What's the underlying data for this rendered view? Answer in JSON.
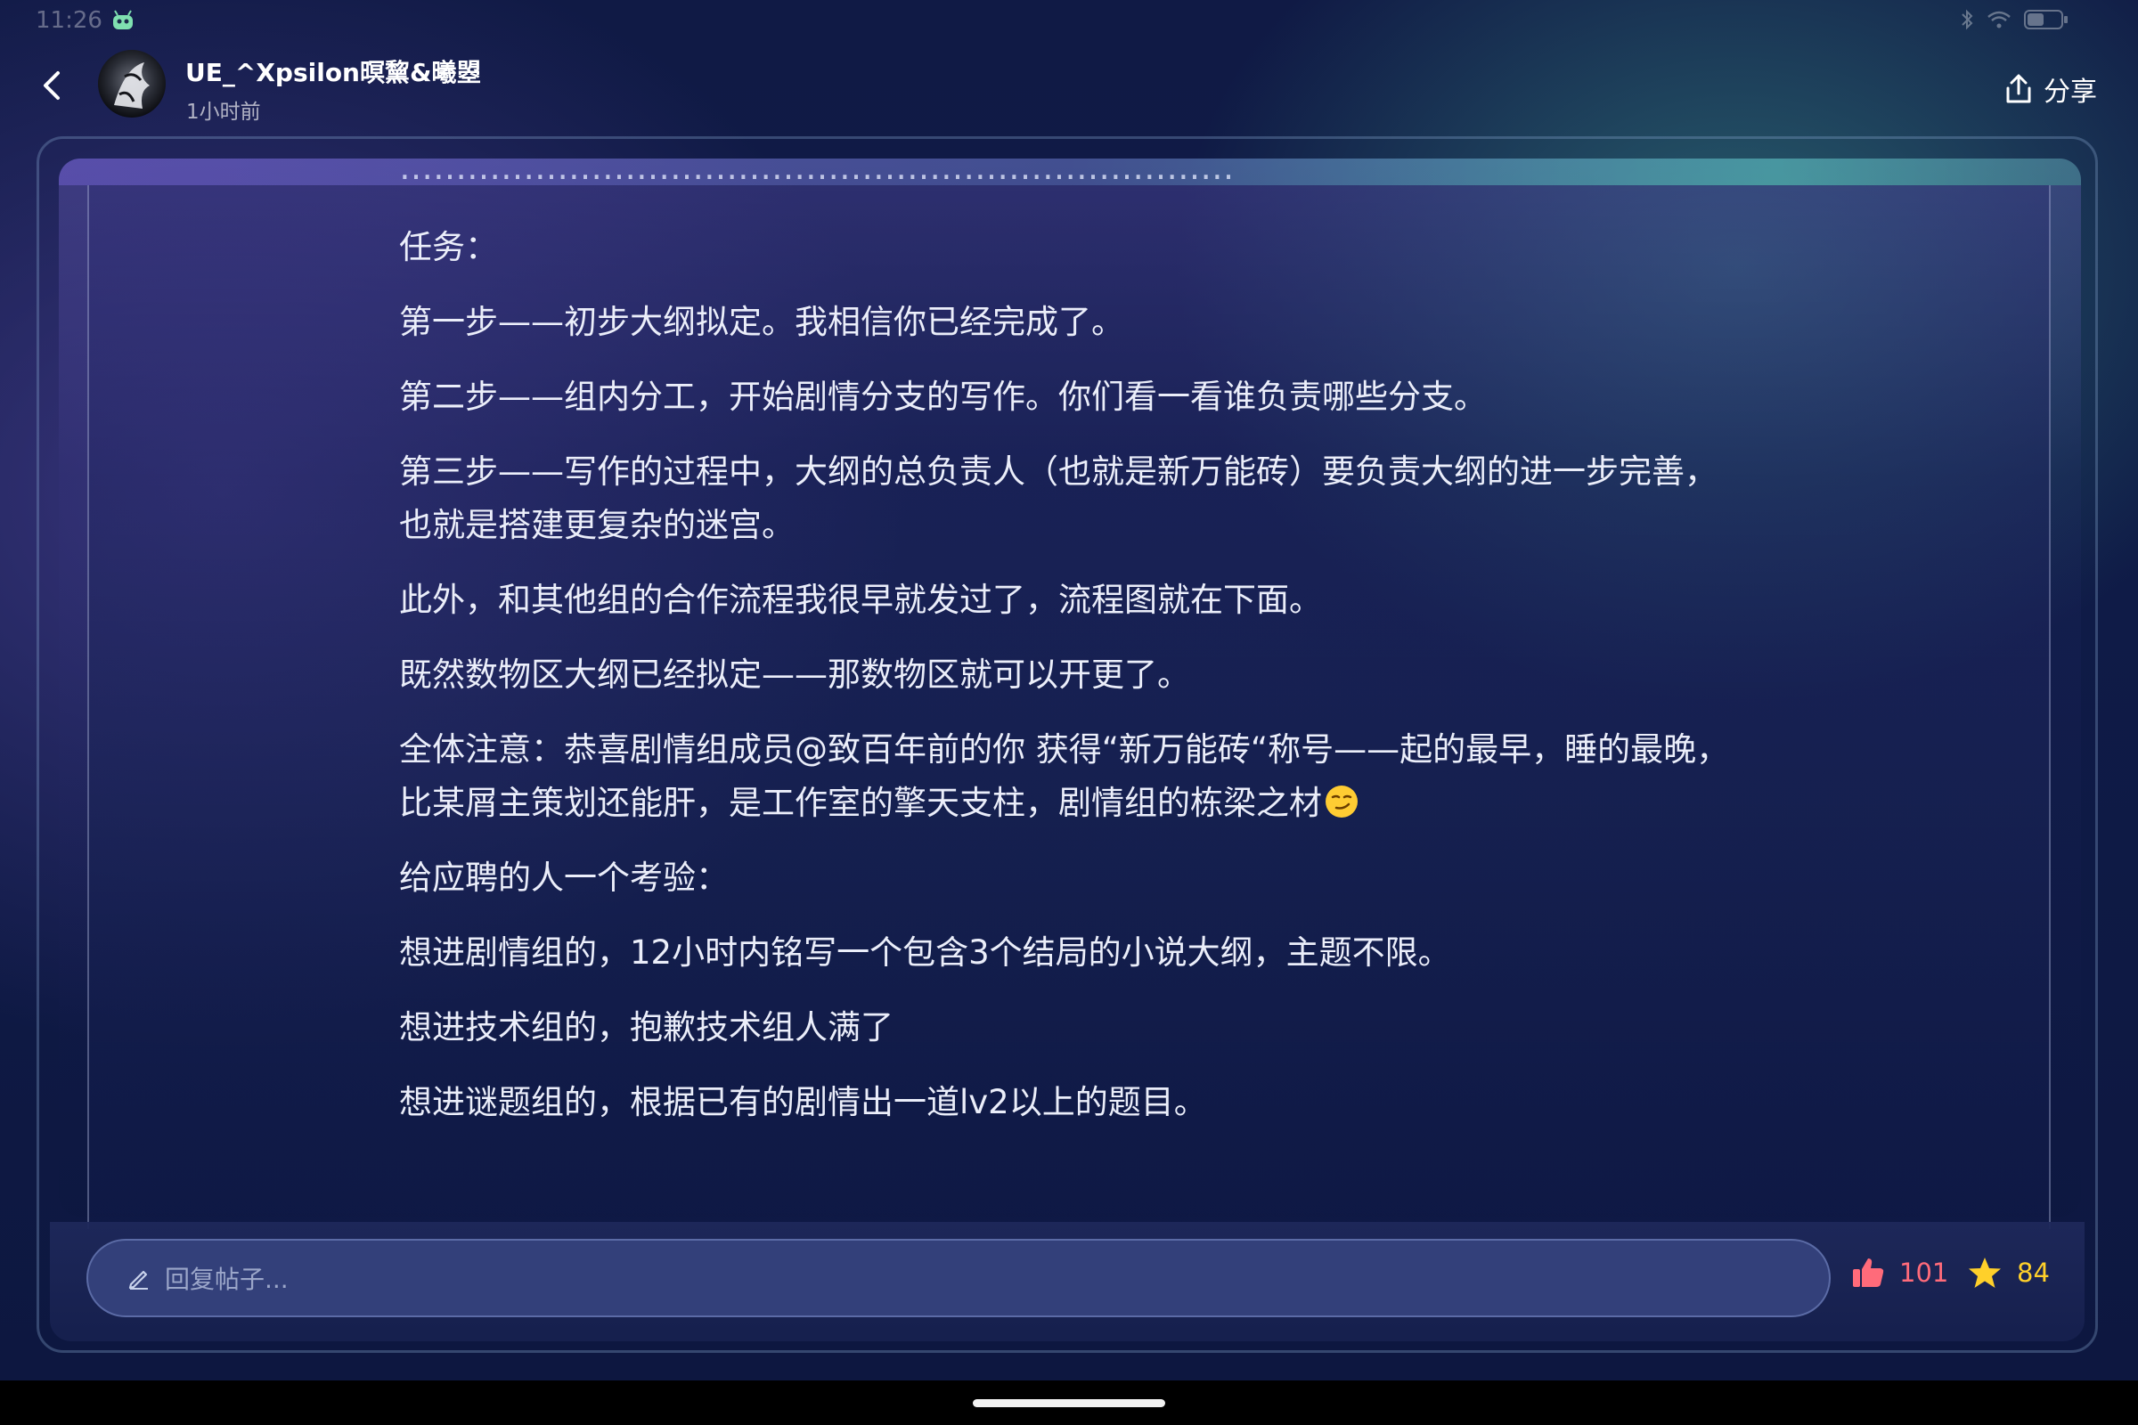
{
  "status_bar": {
    "time": "11:26",
    "icons": [
      "app-robot-icon",
      "bluetooth-icon",
      "wifi-icon",
      "battery-icon"
    ]
  },
  "header": {
    "back_icon": "chevron-left-icon",
    "username": "UE_^Xpsilon暝黧&曦曌",
    "post_time": "1小时前",
    "share_label": "分享",
    "share_icon": "share-icon"
  },
  "post": {
    "paragraphs": [
      "任务：",
      "第一步——初步大纲拟定。我相信你已经完成了。",
      "第二步——组内分工，开始剧情分支的写作。你们看一看谁负责哪些分支。",
      "第三步——写作的过程中，大纲的总负责人（也就是新万能砖）要负责大纲的进一步完善，也就是搭建更复杂的迷宫。",
      "此外，和其他组的合作流程我很早就发过了，流程图就在下面。",
      "既然数物区大纲已经拟定——那数物区就可以开更了。",
      "全体注意：恭喜剧情组成员@致百年前的你 获得“新万能砖“称号——起的最早，睡的最晚，比某屑主策划还能肝，是工作室的擎天支柱，剧情组的栋梁之材",
      "给应聘的人一个考验：",
      "想进剧情组的，12小时内铭写一个包含3个结局的小说大纲，主题不限。",
      "想进技术组的，抱歉技术组人满了",
      "想进谜题组的，根据已有的剧情出一道lv2以上的题目。"
    ],
    "emoji_icon": "smirk-emoji-icon"
  },
  "reply_bar": {
    "placeholder": "回复帖子...",
    "pencil_icon": "pencil-icon",
    "like_count": "101",
    "like_icon": "thumbs-up-icon",
    "favorite_count": "84",
    "favorite_icon": "star-icon"
  },
  "colors": {
    "accent_like": "#ff6b7a",
    "accent_favorite": "#ffd02a",
    "background": "#0f1b47"
  }
}
